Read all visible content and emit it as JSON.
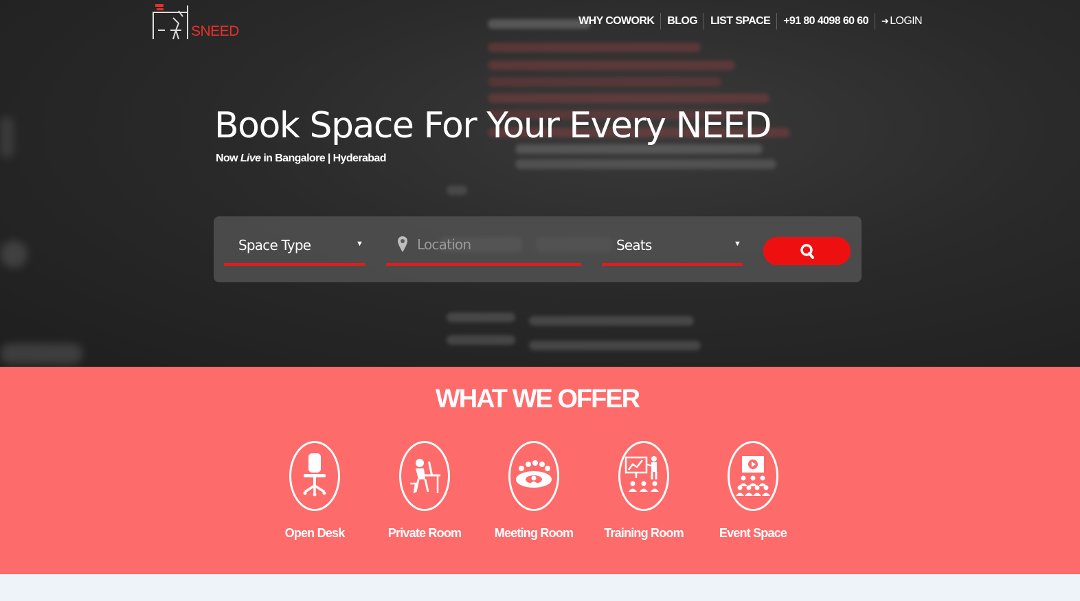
{
  "brand": {
    "logo_text": "SNEED"
  },
  "nav": {
    "items": [
      {
        "label": "WHY COWORK"
      },
      {
        "label": "BLOG"
      },
      {
        "label": "LIST SPACE"
      },
      {
        "label": "+91 80 4098 60 60"
      },
      {
        "label": "LOGIN",
        "icon": "login-icon"
      }
    ]
  },
  "hero": {
    "title": "Book Space For Your Every NEED",
    "subtitle_prefix": "Now",
    "subtitle_emphasis": "Live",
    "subtitle_suffix": "in Bangalore | Hyderabad"
  },
  "search": {
    "space_type": {
      "value": "Space Type"
    },
    "location": {
      "placeholder": "Location",
      "icon": "map-pin-icon"
    },
    "seats": {
      "value": "Seats"
    },
    "button": {
      "icon": "search-icon"
    }
  },
  "offer": {
    "title": "WHAT WE OFFER",
    "items": [
      {
        "label": "Open Desk",
        "icon": "office-chair-icon"
      },
      {
        "label": "Private Room",
        "icon": "person-at-desk-icon"
      },
      {
        "label": "Meeting Room",
        "icon": "meeting-table-icon"
      },
      {
        "label": "Training Room",
        "icon": "presentation-icon"
      },
      {
        "label": "Event Space",
        "icon": "event-audience-icon"
      }
    ]
  },
  "colors": {
    "accent": "#e51a1a",
    "offer_bg": "#fe6b6b",
    "hero_bg": "#2a2a2a"
  }
}
